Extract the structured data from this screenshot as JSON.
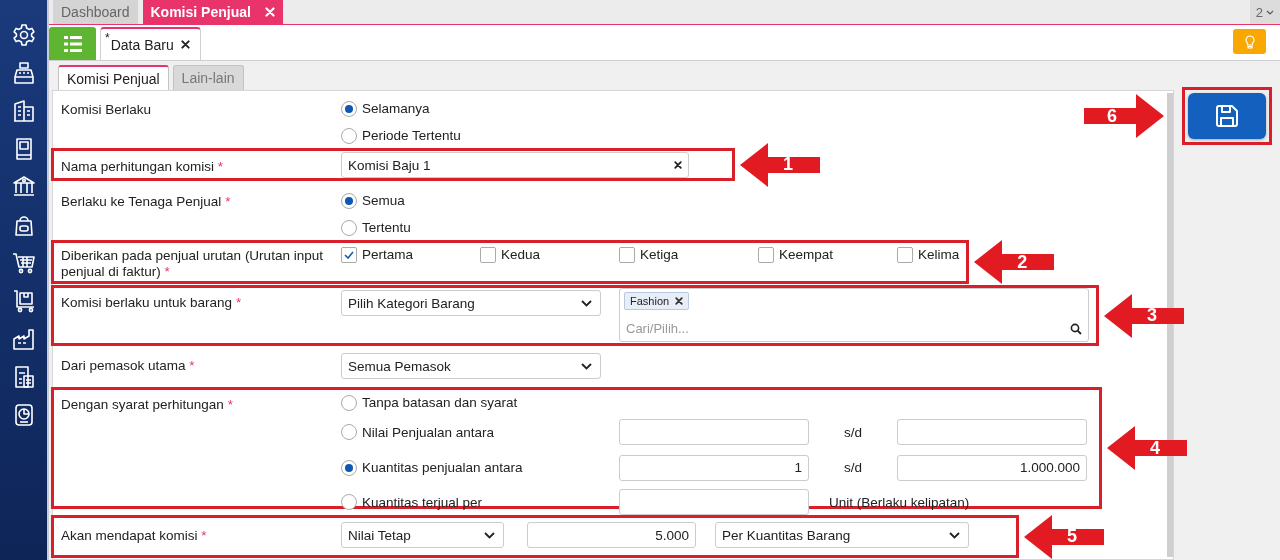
{
  "top_tabs": [
    {
      "label": "Dashboard",
      "selected": false,
      "closable": false
    },
    {
      "label": "Komisi Penjual",
      "selected": true,
      "closable": true
    }
  ],
  "tab_count": "2",
  "doc_tab": {
    "marker": "*",
    "label": "Data Baru"
  },
  "form_tabs": [
    {
      "label": "Komisi Penjual",
      "selected": true
    },
    {
      "label": "Lain-lain",
      "selected": false
    }
  ],
  "required_mark": "*",
  "rows": [
    {
      "kind": "radio",
      "label": "Komisi Berlaku",
      "required": false,
      "options": [
        {
          "label": "Selamanya",
          "selected": true
        },
        {
          "label": "Periode Tertentu",
          "selected": false
        }
      ]
    },
    {
      "kind": "text",
      "label": "Nama perhitungan komisi",
      "required": true,
      "value": "Komisi Baju 1",
      "callout": "1"
    },
    {
      "kind": "radio",
      "label": "Berlaku ke Tenaga Penjual",
      "required": true,
      "options": [
        {
          "label": "Semua",
          "selected": true
        },
        {
          "label": "Tertentu",
          "selected": false
        }
      ]
    },
    {
      "kind": "checks",
      "label": "Diberikan pada penjual urutan (Urutan input penjual di faktur)",
      "required": true,
      "callout": "2",
      "options": [
        {
          "label": "Pertama",
          "checked": true
        },
        {
          "label": "Kedua",
          "checked": false
        },
        {
          "label": "Ketiga",
          "checked": false
        },
        {
          "label": "Keempat",
          "checked": false
        },
        {
          "label": "Kelima",
          "checked": false
        }
      ]
    },
    {
      "kind": "select-tags",
      "label": "Komisi berlaku untuk barang",
      "required": true,
      "callout": "3",
      "select": "Pilih Kategori Barang",
      "tags": [
        "Fashion"
      ],
      "placeholder": "Cari/Pilih..."
    },
    {
      "kind": "select",
      "label": "Dari pemasok utama",
      "required": true,
      "select": "Semua Pemasok"
    },
    {
      "kind": "conditions",
      "label": "Dengan syarat perhitungan",
      "required": true,
      "callout": "4",
      "options": [
        {
          "kind": "plain",
          "label": "Tanpa batasan dan syarat",
          "selected": false
        },
        {
          "kind": "range",
          "label": "Nilai Penjualan antara",
          "selected": false,
          "separator": "s/d"
        },
        {
          "kind": "range",
          "label": "Kuantitas penjualan antara",
          "selected": true,
          "from": "1",
          "separator": "s/d",
          "to": "1.000.000"
        },
        {
          "kind": "per",
          "label": "Kuantitas terjual per",
          "selected": false,
          "note": "Unit (Berlaku kelipatan)"
        }
      ]
    },
    {
      "kind": "commission",
      "label": "Akan mendapat komisi",
      "required": true,
      "callout": "5",
      "type": "Nilai Tetap",
      "amount": "5.000",
      "basis": "Per Kuantitas Barang"
    }
  ],
  "save_button": {
    "callout": "6"
  }
}
